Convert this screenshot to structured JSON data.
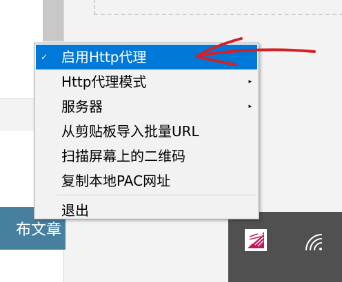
{
  "background": {
    "publish_button_label": "布文章"
  },
  "context_menu": {
    "items": [
      {
        "label": "启用Http代理",
        "checked": true,
        "highlighted": true,
        "has_submenu": false
      },
      {
        "label": "Http代理模式",
        "checked": false,
        "highlighted": false,
        "has_submenu": true
      },
      {
        "label": "服务器",
        "checked": false,
        "highlighted": false,
        "has_submenu": true
      },
      {
        "label": "从剪贴板导入批量URL",
        "checked": false,
        "highlighted": false,
        "has_submenu": false
      },
      {
        "label": "扫描屏幕上的二维码",
        "checked": false,
        "highlighted": false,
        "has_submenu": false
      },
      {
        "label": "复制本地PAC网址",
        "checked": false,
        "highlighted": false,
        "has_submenu": false
      },
      {
        "label": "退出",
        "checked": false,
        "highlighted": false,
        "has_submenu": false
      }
    ],
    "highlight_color": "#0078d7"
  },
  "icons": {
    "check": "✓",
    "submenu_arrow": "▸",
    "tray_app": "tray-app-icon",
    "wifi": "wifi-icon"
  },
  "annotation": {
    "arrow_color": "#d42028"
  }
}
